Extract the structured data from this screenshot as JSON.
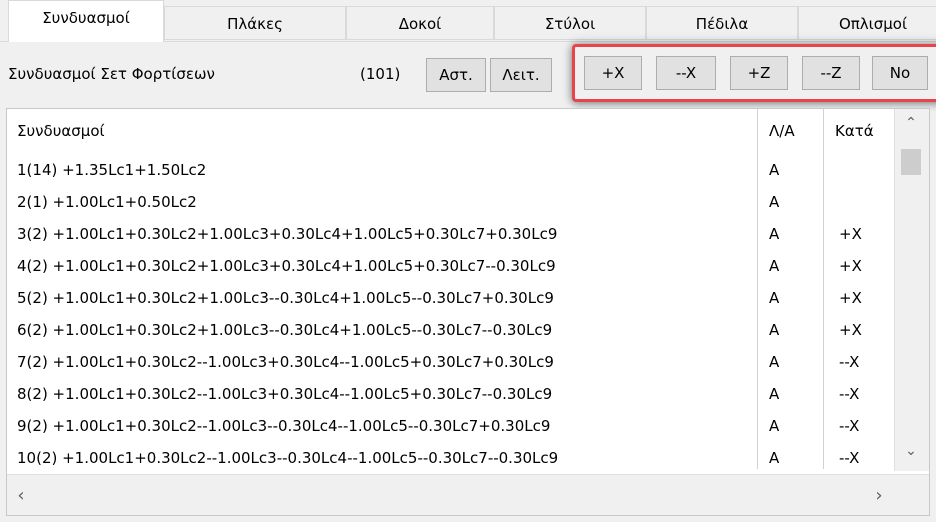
{
  "tabs": [
    "Συνδυασμοί",
    "Πλάκες",
    "Δοκοί",
    "Στύλοι",
    "Πέδιλα",
    "Οπλισμοί"
  ],
  "toolbar": {
    "label": "Συνδυασμοί Σετ Φορτίσεων",
    "count": "(101)",
    "ast_button": "Αστ.",
    "leit_button": "Λειτ.",
    "dir_buttons": [
      "+X",
      "--X",
      "+Z",
      "--Z",
      "No"
    ]
  },
  "grid": {
    "columns": [
      "Συνδυασμοί",
      "Λ/Α",
      "Κατά"
    ],
    "rows": [
      {
        "combo": "1(14) +1.35Lc1+1.50Lc2",
        "la": "A",
        "kata": ""
      },
      {
        "combo": "2(1) +1.00Lc1+0.50Lc2",
        "la": "A",
        "kata": ""
      },
      {
        "combo": "3(2) +1.00Lc1+0.30Lc2+1.00Lc3+0.30Lc4+1.00Lc5+0.30Lc7+0.30Lc9",
        "la": "A",
        "kata": "+X"
      },
      {
        "combo": "4(2) +1.00Lc1+0.30Lc2+1.00Lc3+0.30Lc4+1.00Lc5+0.30Lc7--0.30Lc9",
        "la": "A",
        "kata": "+X"
      },
      {
        "combo": "5(2) +1.00Lc1+0.30Lc2+1.00Lc3--0.30Lc4+1.00Lc5--0.30Lc7+0.30Lc9",
        "la": "A",
        "kata": "+X"
      },
      {
        "combo": "6(2) +1.00Lc1+0.30Lc2+1.00Lc3--0.30Lc4+1.00Lc5--0.30Lc7--0.30Lc9",
        "la": "A",
        "kata": "+X"
      },
      {
        "combo": "7(2) +1.00Lc1+0.30Lc2--1.00Lc3+0.30Lc4--1.00Lc5+0.30Lc7+0.30Lc9",
        "la": "A",
        "kata": "--X"
      },
      {
        "combo": "8(2) +1.00Lc1+0.30Lc2--1.00Lc3+0.30Lc4--1.00Lc5+0.30Lc7--0.30Lc9",
        "la": "A",
        "kata": "--X"
      },
      {
        "combo": "9(2) +1.00Lc1+0.30Lc2--1.00Lc3--0.30Lc4--1.00Lc5--0.30Lc7+0.30Lc9",
        "la": "A",
        "kata": "--X"
      },
      {
        "combo": "10(2) +1.00Lc1+0.30Lc2--1.00Lc3--0.30Lc4--1.00Lc5--0.30Lc7--0.30Lc9",
        "la": "A",
        "kata": "--X"
      }
    ]
  },
  "colors": {
    "highlight": "#e8454b"
  }
}
